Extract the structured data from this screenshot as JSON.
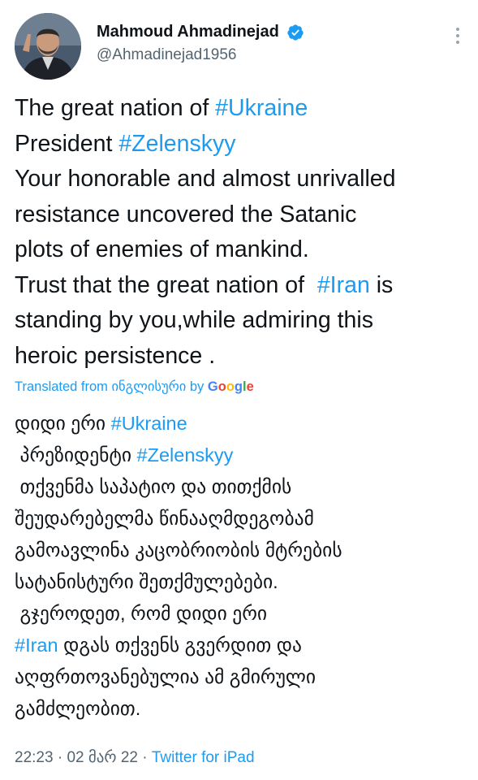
{
  "tweet": {
    "author": {
      "display_name": "Mahmoud Ahmadinejad",
      "handle": "@Ahmadinejad1956",
      "verified": true
    },
    "more_icon": "more-dots-vertical",
    "text": {
      "line1": {
        "text": "The great nation of ",
        "hashtag": "#Ukraine"
      },
      "line2": {
        "text": "President ",
        "hashtag": "#Zelenskyy"
      },
      "line3": "Your honorable and almost unrivalled",
      "line4": "resistance uncovered the Satanic",
      "line5": "plots of enemies of mankind.",
      "line6": {
        "text": "Trust that the great nation of  ",
        "hashtag": "#Iran",
        "after": " is"
      },
      "line7": "standing by you,while admiring this",
      "line8": "heroic persistence ."
    },
    "translation_label": {
      "prefix": "Translated from ინგლისური by ",
      "g1": "G",
      "g2": "o",
      "g3": "o",
      "g4": "g",
      "g5": "l",
      "g6": "e"
    },
    "translation": {
      "line1": {
        "text": "დიდი ერი ",
        "hashtag": "#Ukraine"
      },
      "line2": {
        "text": " პრეზიდენტი ",
        "hashtag": "#Zelenskyy"
      },
      "line3": " თქვენმა საპატიო და თითქმის",
      "line4": "შეუდარებელმა წინააღმდეგობამ",
      "line5": "გამოავლინა კაცობრიობის მტრების",
      "line6": "სატანისტური შეთქმულებები.",
      "line7": " გჯეროდეთ, რომ დიდი ერი",
      "line8": {
        "hashtag": "#Iran",
        "after": " დგას თქვენს გვერდით და"
      },
      "line9": "აღფრთოვანებულია ამ გმირული",
      "line10": "გამძლეობით."
    },
    "meta": {
      "time": "22:23",
      "sep1": " · ",
      "date": "02 მარ 22",
      "sep2": " · ",
      "source": "Twitter for iPad"
    },
    "colors": {
      "link": "#1d9bf0",
      "text": "#0f1419",
      "muted": "#536471"
    }
  }
}
